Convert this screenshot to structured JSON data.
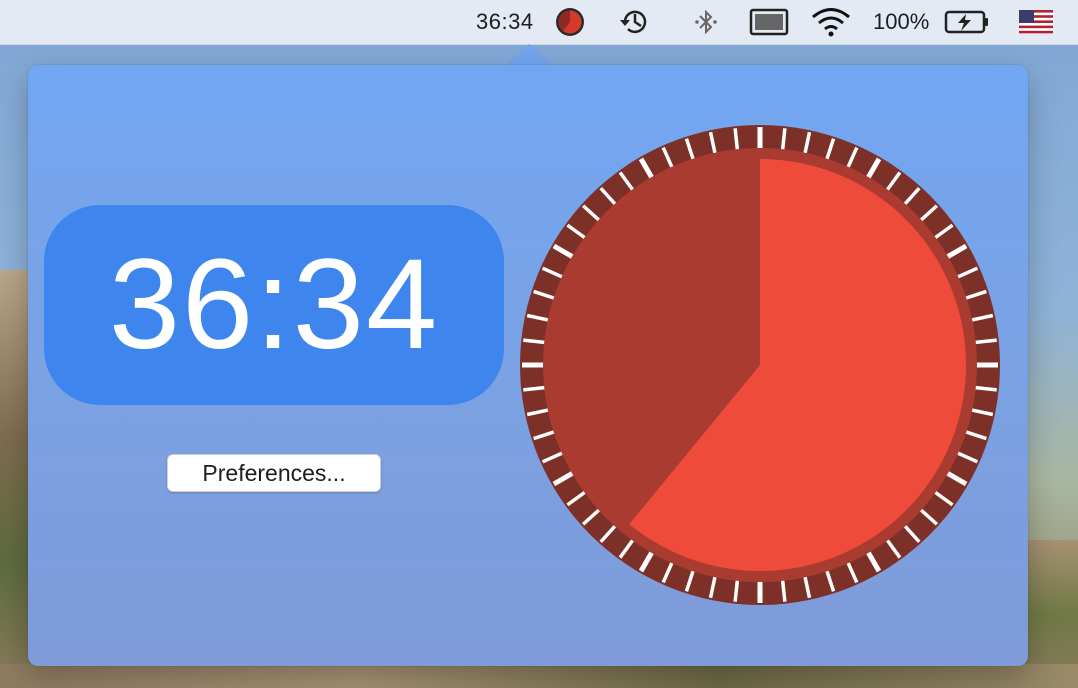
{
  "menubar": {
    "clock_text": "36:34",
    "battery_text": "100%",
    "icons": [
      "timer-pie-icon",
      "time-machine-icon",
      "bluetooth-icon",
      "sidecar-icon",
      "wifi-icon",
      "battery-charging-icon",
      "us-flag-icon"
    ]
  },
  "popover": {
    "time_text": "36:34",
    "preferences_label": "Preferences..."
  },
  "timer": {
    "remaining_minutes": 36.57,
    "total_minutes": 60,
    "remaining_fraction": 0.6094
  },
  "colors": {
    "accent": "#3e86ee",
    "dial_face": "#ee4b3b",
    "dial_elapsed": "#aa3b31",
    "dial_rim": "#7d3028"
  }
}
